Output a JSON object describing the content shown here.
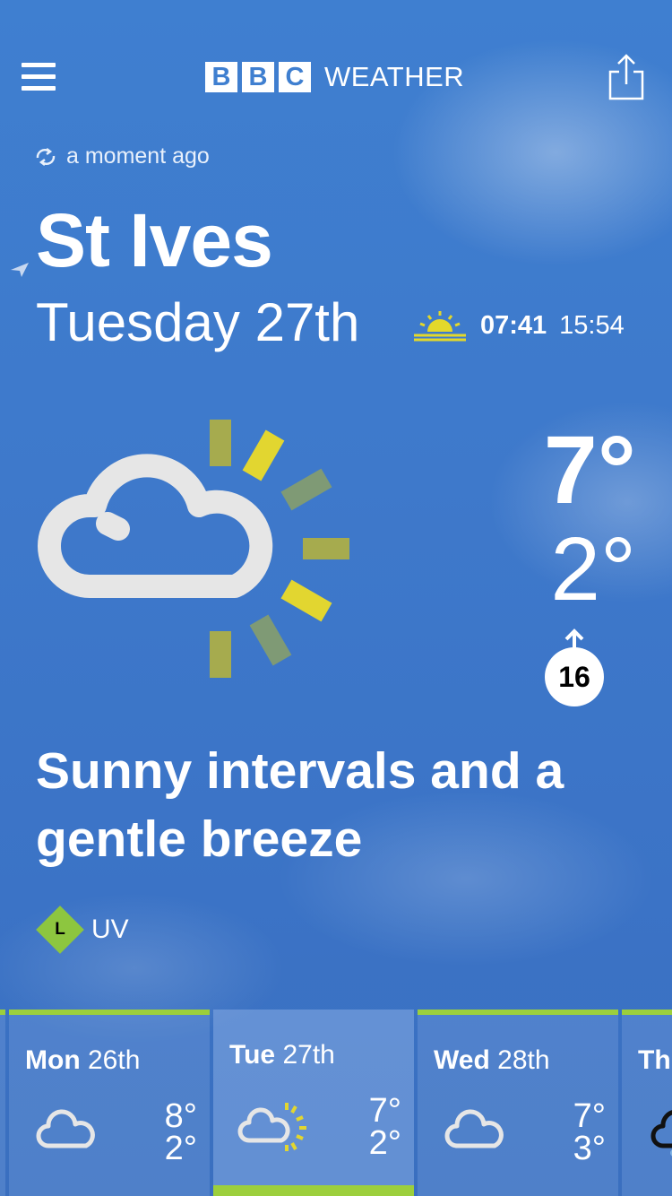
{
  "header": {
    "menu_icon": "hamburger-icon",
    "bbc_letters": [
      "B",
      "B",
      "C"
    ],
    "brand_word": "WEATHER",
    "share_icon": "share-icon"
  },
  "refresh": {
    "text": "a moment ago",
    "icon": "refresh-icon"
  },
  "location": {
    "name": "St Ives",
    "date": "Tuesday 27th"
  },
  "sun": {
    "sunrise": "07:41",
    "sunset": "15:54"
  },
  "current": {
    "temp_max": "7°",
    "temp_min": "2°",
    "wind_speed": "16",
    "summary": "Sunny intervals and a gentle breeze",
    "weather_icon": "sunny-intervals-icon"
  },
  "uv": {
    "level": "L",
    "label": "UV",
    "color": "#8dc63f"
  },
  "forecast": [
    {
      "day": "Mon",
      "date": "26th",
      "max": "8°",
      "min": "2°",
      "icon": "cloud-icon"
    },
    {
      "day": "Tue",
      "date": "27th",
      "max": "7°",
      "min": "2°",
      "icon": "sunny-intervals-icon"
    },
    {
      "day": "Wed",
      "date": "28th",
      "max": "7°",
      "min": "3°",
      "icon": "cloud-icon"
    },
    {
      "day": "Th",
      "date": "",
      "max": "",
      "min": "",
      "icon": "drizzle-icon"
    }
  ],
  "colors": {
    "accent_green": "#9ccf3c",
    "sun_yellow": "#e3d82b",
    "bg_blue": "#3e79cb"
  }
}
